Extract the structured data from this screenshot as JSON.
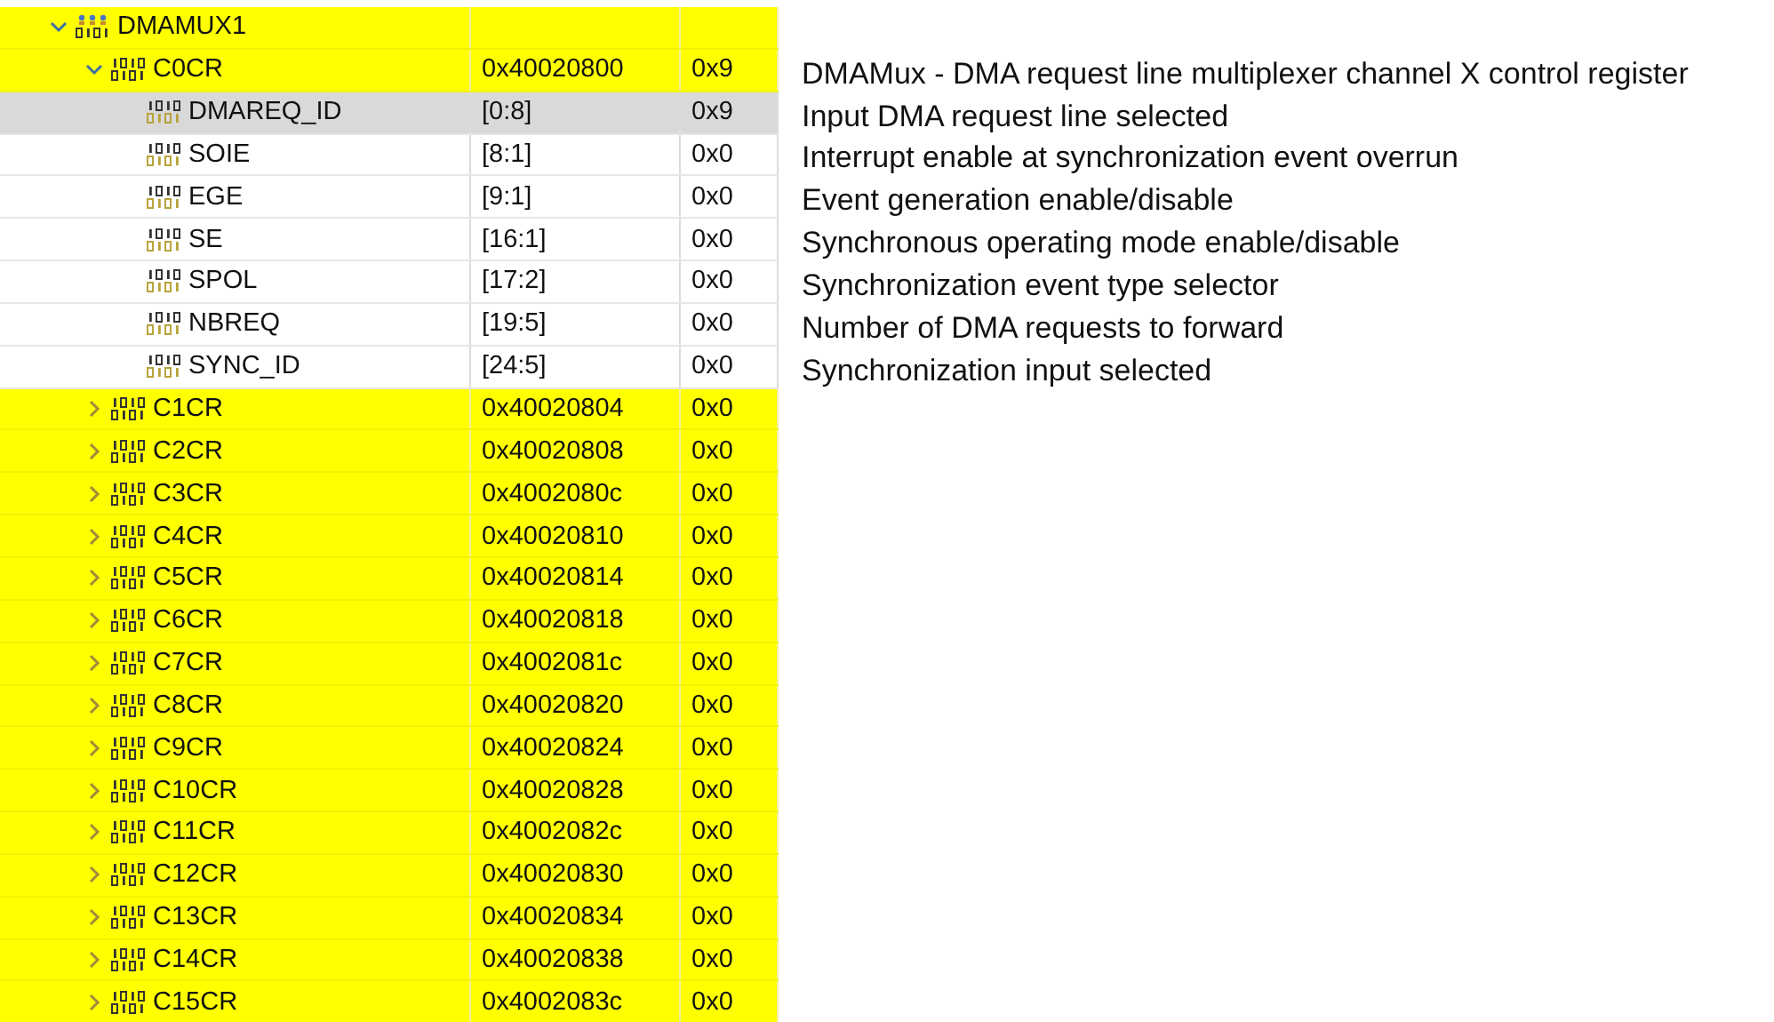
{
  "registers_tree": {
    "rows": [
      {
        "kind": "peripheral",
        "name": "DMAMUX1",
        "expanded": true,
        "highlighted": true,
        "selected": false,
        "children": [
          {
            "kind": "register",
            "name": "C0CR",
            "address": "0x40020800",
            "value": "0x9",
            "expanded": true,
            "highlighted": true,
            "selected": false,
            "children": [
              {
                "kind": "field",
                "name": "DMAREQ_ID",
                "address": "[0:8]",
                "value": "0x9",
                "highlighted": false,
                "selected": true
              },
              {
                "kind": "field",
                "name": "SOIE",
                "address": "[8:1]",
                "value": "0x0",
                "highlighted": false,
                "selected": false
              },
              {
                "kind": "field",
                "name": "EGE",
                "address": "[9:1]",
                "value": "0x0",
                "highlighted": false,
                "selected": false
              },
              {
                "kind": "field",
                "name": "SE",
                "address": "[16:1]",
                "value": "0x0",
                "highlighted": false,
                "selected": false
              },
              {
                "kind": "field",
                "name": "SPOL",
                "address": "[17:2]",
                "value": "0x0",
                "highlighted": false,
                "selected": false
              },
              {
                "kind": "field",
                "name": "NBREQ",
                "address": "[19:5]",
                "value": "0x0",
                "highlighted": false,
                "selected": false
              },
              {
                "kind": "field",
                "name": "SYNC_ID",
                "address": "[24:5]",
                "value": "0x0",
                "highlighted": false,
                "selected": false
              }
            ]
          },
          {
            "kind": "register",
            "name": "C1CR",
            "address": "0x40020804",
            "value": "0x0",
            "expanded": false,
            "highlighted": true,
            "selected": false
          },
          {
            "kind": "register",
            "name": "C2CR",
            "address": "0x40020808",
            "value": "0x0",
            "expanded": false,
            "highlighted": true,
            "selected": false
          },
          {
            "kind": "register",
            "name": "C3CR",
            "address": "0x4002080c",
            "value": "0x0",
            "expanded": false,
            "highlighted": true,
            "selected": false
          },
          {
            "kind": "register",
            "name": "C4CR",
            "address": "0x40020810",
            "value": "0x0",
            "expanded": false,
            "highlighted": true,
            "selected": false
          },
          {
            "kind": "register",
            "name": "C5CR",
            "address": "0x40020814",
            "value": "0x0",
            "expanded": false,
            "highlighted": true,
            "selected": false
          },
          {
            "kind": "register",
            "name": "C6CR",
            "address": "0x40020818",
            "value": "0x0",
            "expanded": false,
            "highlighted": true,
            "selected": false
          },
          {
            "kind": "register",
            "name": "C7CR",
            "address": "0x4002081c",
            "value": "0x0",
            "expanded": false,
            "highlighted": true,
            "selected": false
          },
          {
            "kind": "register",
            "name": "C8CR",
            "address": "0x40020820",
            "value": "0x0",
            "expanded": false,
            "highlighted": true,
            "selected": false
          },
          {
            "kind": "register",
            "name": "C9CR",
            "address": "0x40020824",
            "value": "0x0",
            "expanded": false,
            "highlighted": true,
            "selected": false
          },
          {
            "kind": "register",
            "name": "C10CR",
            "address": "0x40020828",
            "value": "0x0",
            "expanded": false,
            "highlighted": true,
            "selected": false
          },
          {
            "kind": "register",
            "name": "C11CR",
            "address": "0x4002082c",
            "value": "0x0",
            "expanded": false,
            "highlighted": true,
            "selected": false
          },
          {
            "kind": "register",
            "name": "C12CR",
            "address": "0x40020830",
            "value": "0x0",
            "expanded": false,
            "highlighted": true,
            "selected": false
          },
          {
            "kind": "register",
            "name": "C13CR",
            "address": "0x40020834",
            "value": "0x0",
            "expanded": false,
            "highlighted": true,
            "selected": false
          },
          {
            "kind": "register",
            "name": "C14CR",
            "address": "0x40020838",
            "value": "0x0",
            "expanded": false,
            "highlighted": true,
            "selected": false
          },
          {
            "kind": "register",
            "name": "C15CR",
            "address": "0x4002083c",
            "value": "0x0",
            "expanded": false,
            "highlighted": true,
            "selected": false
          }
        ]
      }
    ]
  },
  "descriptions": [
    "DMAMux - DMA request line multiplexer channel X control register",
    "Input DMA request line selected",
    "Interrupt enable at synchronization event overrun",
    "Event generation enable/disable",
    "Synchronous operating mode enable/disable",
    "Synchronization event type selector",
    "Number of DMA requests to forward",
    "Synchronization input selected"
  ]
}
